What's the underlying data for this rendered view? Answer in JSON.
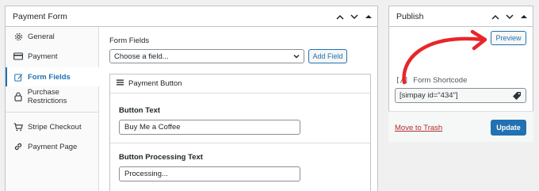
{
  "main_panel": {
    "title": "Payment Form"
  },
  "sidebar": {
    "items": [
      {
        "label": "General",
        "icon": "gear-icon"
      },
      {
        "label": "Payment",
        "icon": "credit-card-icon"
      },
      {
        "label": "Form Fields",
        "icon": "edit-icon",
        "active": true
      },
      {
        "label": "Purchase Restrictions",
        "icon": "lock-icon"
      },
      {
        "label": "Stripe Checkout",
        "icon": "cart-icon"
      },
      {
        "label": "Payment Page",
        "icon": "link-icon"
      }
    ]
  },
  "form_fields": {
    "label": "Form Fields",
    "select_value": "Choose a field...",
    "add_button": "Add Field"
  },
  "payment_button": {
    "title": "Payment Button",
    "button_text_label": "Button Text",
    "button_text_value": "Buy Me a Coffee",
    "processing_label": "Button Processing Text",
    "processing_value": "Processing..."
  },
  "publish": {
    "title": "Publish",
    "preview_button": "Preview",
    "shortcode_prefix": "[/]",
    "shortcode_label": "Form Shortcode",
    "shortcode_value": "[simpay id=\"434\"]",
    "trash_link": "Move to Trash",
    "update_button": "Update"
  },
  "colors": {
    "accent": "#2271b1",
    "danger": "#b32d2e",
    "annotation_arrow": "#e8262a"
  }
}
